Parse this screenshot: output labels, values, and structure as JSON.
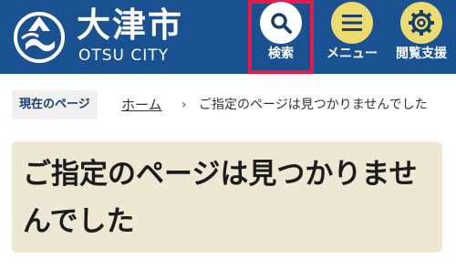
{
  "header": {
    "site_name_ja": "大津市",
    "site_name_en": "OTSU CITY",
    "search_label": "検索",
    "menu_label": "メニュー",
    "accessibility_label": "閲覧支援"
  },
  "breadcrumb": {
    "tag": "現在のページ",
    "home": "ホーム",
    "separator": "›",
    "current": "ご指定のページは見つかりませんでした"
  },
  "main": {
    "title": "ご指定のページは見つかりませんでした"
  },
  "colors": {
    "header_bg": "#1a5190",
    "button_yellow": "#ecdb71",
    "highlight_border": "#e8184a",
    "title_bg": "#ede7d3"
  },
  "icons": {
    "search": "search-icon",
    "menu": "hamburger-icon",
    "accessibility": "gear-icon",
    "logo": "city-emblem-icon"
  }
}
